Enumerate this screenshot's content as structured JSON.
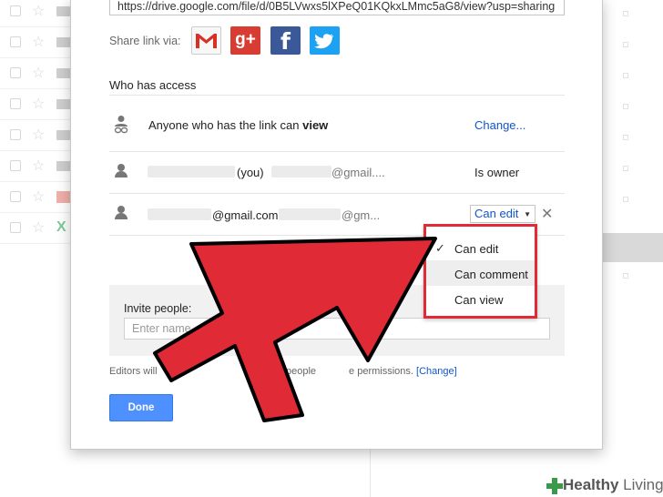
{
  "share": {
    "link_url": "https://drive.google.com/file/d/0B5LVwxs5lXPeQ01KQkxLMmc5aG8/view?usp=sharing",
    "share_via_label": "Share link via:",
    "social": {
      "gplus": "g+",
      "facebook": "f"
    }
  },
  "access": {
    "heading": "Who has access",
    "link_row": {
      "text_prefix": "Anyone who has the link can ",
      "text_bold": "view",
      "change": "Change..."
    },
    "owner_row": {
      "you": "(you)",
      "email": "@gmail....",
      "role": "Is owner"
    },
    "editor_row": {
      "email_left": "@gmail.com",
      "email_right": "@gm...",
      "role": "Can edit"
    }
  },
  "permission_menu": {
    "options": [
      "Can edit",
      "Can comment",
      "Can view"
    ],
    "selected": "Can edit",
    "hovered": "Can comment"
  },
  "invite": {
    "label": "Invite people:",
    "placeholder": "Enter name"
  },
  "footer": {
    "editors_prefix": "Editors will",
    "editors_mid": "add people",
    "editors_suffix": "e permissions.",
    "change_link": "[Change]",
    "done_label": "Done"
  },
  "watermark": {
    "brand_a": "Healthy",
    "brand_b": " Living"
  },
  "colors": {
    "accent_red": "#e02a36",
    "done_blue": "#4d90fe",
    "link_blue": "#1155cc"
  }
}
